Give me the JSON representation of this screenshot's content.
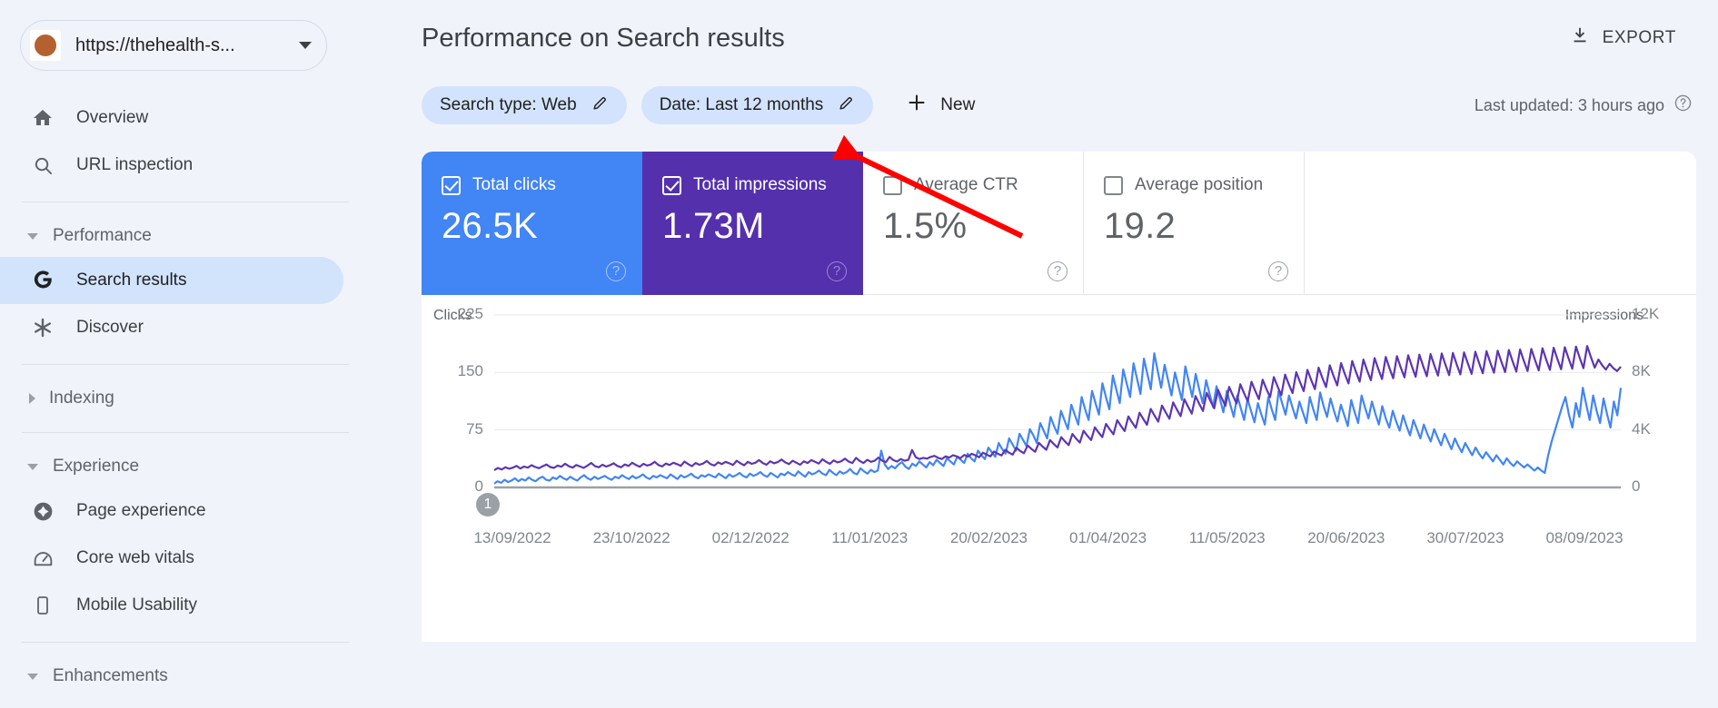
{
  "sidebar": {
    "property": {
      "url": "https://thehealth-s...",
      "favicon_color": "#b5602f",
      "dropdown_icon": "chevron-down-icon"
    },
    "items": [
      {
        "label": "Overview",
        "icon": "home-icon",
        "type": "item",
        "selected": false
      },
      {
        "label": "URL inspection",
        "icon": "search-icon",
        "type": "item",
        "selected": false
      },
      {
        "label": "Performance",
        "icon": "chevron-down-icon",
        "type": "group",
        "expanded": true
      },
      {
        "label": "Search results",
        "icon": "google-g-icon",
        "type": "item",
        "selected": true
      },
      {
        "label": "Discover",
        "icon": "asterisk-icon",
        "type": "item",
        "selected": false
      },
      {
        "label": "Indexing",
        "icon": "chevron-right-icon",
        "type": "group",
        "expanded": false
      },
      {
        "label": "Experience",
        "icon": "chevron-down-icon",
        "type": "group",
        "expanded": true
      },
      {
        "label": "Page experience",
        "icon": "page-experience-icon",
        "type": "item",
        "selected": false
      },
      {
        "label": "Core web vitals",
        "icon": "speedometer-icon",
        "type": "item",
        "selected": false
      },
      {
        "label": "Mobile Usability",
        "icon": "mobile-phone-icon",
        "type": "item",
        "selected": false
      },
      {
        "label": "Enhancements",
        "icon": "chevron-down-icon",
        "type": "group",
        "expanded": true
      }
    ]
  },
  "header": {
    "title": "Performance on Search results",
    "export_label": "EXPORT",
    "export_icon": "download-icon"
  },
  "filters": {
    "chips": [
      {
        "label": "Search type: Web",
        "edit_icon": "pencil-icon"
      },
      {
        "label": "Date: Last 12 months",
        "edit_icon": "pencil-icon"
      }
    ],
    "new_label": "New",
    "new_icon": "plus-icon",
    "last_updated": "Last updated: 3 hours ago",
    "help_icon": "question-mark-icon"
  },
  "metrics": [
    {
      "name": "Total clicks",
      "value": "26.5K",
      "checked": true,
      "color": "#4285f4",
      "help_icon": "question-mark-icon"
    },
    {
      "name": "Total impressions",
      "value": "1.73M",
      "checked": true,
      "color": "#5430ad",
      "help_icon": "question-mark-icon"
    },
    {
      "name": "Average CTR",
      "value": "1.5%",
      "checked": false,
      "color": "#ffffff",
      "help_icon": "question-mark-icon"
    },
    {
      "name": "Average position",
      "value": "19.2",
      "checked": false,
      "color": "#ffffff",
      "help_icon": "question-mark-icon"
    }
  ],
  "annotation": {
    "marker_label": "1"
  },
  "chart_data": {
    "type": "line",
    "title": "",
    "xlabel": "",
    "ylabel": "Clicks",
    "y2label": "Impressions",
    "grid": true,
    "legend": "none",
    "ylim": [
      0,
      225
    ],
    "y2lim": [
      0,
      12000
    ],
    "yticks": [
      "0",
      "75",
      "150",
      "225"
    ],
    "y2ticks": [
      "0",
      "4K",
      "8K",
      "12K"
    ],
    "xticks": [
      "13/09/2022",
      "23/10/2022",
      "02/12/2022",
      "11/01/2023",
      "20/02/2023",
      "01/04/2023",
      "11/05/2023",
      "20/06/2023",
      "30/07/2023",
      "08/09/2023"
    ],
    "series": [
      {
        "name": "Clicks",
        "color": "#4285f4",
        "axis": "left",
        "values": [
          5,
          8,
          6,
          10,
          7,
          9,
          12,
          8,
          11,
          9,
          13,
          10,
          8,
          12,
          14,
          10,
          9,
          13,
          11,
          15,
          12,
          10,
          14,
          11,
          9,
          13,
          16,
          12,
          10,
          14,
          11,
          13,
          15,
          12,
          10,
          14,
          12,
          16,
          13,
          11,
          15,
          12,
          14,
          17,
          13,
          11,
          15,
          13,
          16,
          14,
          12,
          17,
          14,
          11,
          16,
          13,
          15,
          18,
          14,
          12,
          16,
          14,
          17,
          15,
          13,
          18,
          15,
          12,
          17,
          14,
          16,
          19,
          15,
          13,
          18,
          15,
          17,
          20,
          16,
          14,
          19,
          16,
          13,
          18,
          16,
          20,
          17,
          15,
          21,
          17,
          14,
          20,
          17,
          19,
          22,
          18,
          16,
          23,
          19,
          16,
          21,
          18,
          20,
          24,
          19,
          17,
          25,
          21,
          18,
          23,
          20,
          22,
          48,
          30,
          24,
          28,
          25,
          30,
          33,
          27,
          24,
          31,
          28,
          34,
          30,
          26,
          33,
          29,
          36,
          32,
          28,
          38,
          34,
          30,
          40,
          36,
          32,
          44,
          38,
          34,
          48,
          42,
          37,
          52,
          46,
          40,
          58,
          50,
          44,
          64,
          56,
          48,
          70,
          62,
          54,
          76,
          68,
          58,
          84,
          74,
          64,
          92,
          80,
          70,
          100,
          88,
          76,
          108,
          95,
          82,
          118,
          102,
          88,
          126,
          110,
          95,
          136,
          118,
          102,
          146,
          128,
          110,
          154,
          136,
          118,
          162,
          142,
          122,
          168,
          148,
          128,
          175,
          152,
          130,
          160,
          140,
          120,
          150,
          132,
          114,
          158,
          138,
          118,
          148,
          128,
          110,
          140,
          122,
          105,
          132,
          115,
          98,
          126,
          108,
          92,
          120,
          104,
          88,
          115,
          100,
          85,
          110,
          95,
          82,
          118,
          102,
          88,
          126,
          110,
          95,
          120,
          104,
          90,
          112,
          98,
          84,
          118,
          102,
          88,
          124,
          106,
          92,
          116,
          100,
          86,
          108,
          94,
          80,
          114,
          98,
          84,
          120,
          104,
          90,
          112,
          96,
          82,
          106,
          90,
          78,
          100,
          86,
          74,
          94,
          80,
          68,
          88,
          76,
          64,
          82,
          70,
          60,
          76,
          65,
          55,
          70,
          60,
          50,
          64,
          54,
          46,
          58,
          50,
          42,
          52,
          44,
          38,
          46,
          40,
          34,
          42,
          36,
          30,
          38,
          32,
          28,
          34,
          30,
          26,
          30,
          26,
          22,
          26,
          22,
          19,
          42,
          60,
          75,
          90,
          105,
          118,
          95,
          78,
          110,
          92,
          130,
          108,
          88,
          120,
          100,
          84,
          116,
          96,
          78,
          112,
          94,
          130
        ]
      },
      {
        "name": "Impressions",
        "color": "#5e35b1",
        "axis": "right",
        "values": [
          1200,
          1350,
          1250,
          1400,
          1300,
          1380,
          1500,
          1320,
          1450,
          1380,
          1550,
          1420,
          1340,
          1480,
          1600,
          1420,
          1360,
          1520,
          1440,
          1650,
          1480,
          1380,
          1560,
          1460,
          1360,
          1520,
          1700,
          1480,
          1400,
          1580,
          1450,
          1540,
          1680,
          1500,
          1400,
          1600,
          1500,
          1720,
          1560,
          1440,
          1640,
          1520,
          1600,
          1780,
          1560,
          1460,
          1660,
          1560,
          1720,
          1620,
          1500,
          1800,
          1620,
          1480,
          1700,
          1580,
          1660,
          1840,
          1620,
          1520,
          1740,
          1620,
          1780,
          1680,
          1560,
          1860,
          1680,
          1540,
          1780,
          1640,
          1720,
          1900,
          1700,
          1580,
          1820,
          1680,
          1760,
          1940,
          1740,
          1620,
          1860,
          1720,
          1580,
          1820,
          1700,
          1900,
          1780,
          1660,
          1960,
          1780,
          1640,
          1880,
          1740,
          1820,
          2000,
          1800,
          1700,
          2060,
          1840,
          1700,
          1920,
          1780,
          1860,
          2080,
          1860,
          1760,
          2120,
          1900,
          1800,
          1980,
          1860,
          1920,
          2600,
          2100,
          1980,
          2060,
          2000,
          2120,
          2200,
          2060,
          1980,
          2160,
          2080,
          2240,
          2160,
          2040,
          2260,
          2140,
          2340,
          2220,
          2100,
          2420,
          2280,
          2160,
          2500,
          2340,
          2220,
          2620,
          2420,
          2280,
          2760,
          2540,
          2380,
          2920,
          2680,
          2480,
          3100,
          2840,
          2620,
          3300,
          3020,
          2780,
          3500,
          3200,
          2940,
          3720,
          3400,
          3120,
          3940,
          3600,
          3300,
          4180,
          3820,
          3500,
          4420,
          4040,
          3700,
          4680,
          4280,
          3920,
          4940,
          4520,
          4140,
          5200,
          4760,
          4360,
          5460,
          5000,
          4580,
          5700,
          5220,
          4780,
          5920,
          5420,
          4960,
          6140,
          5620,
          5140,
          6360,
          5820,
          5320,
          6580,
          6020,
          5500,
          6800,
          6220,
          5680,
          7000,
          6400,
          5840,
          7180,
          6560,
          6000,
          7350,
          6720,
          6140,
          7500,
          6860,
          6280,
          7680,
          7020,
          6420,
          7850,
          7180,
          6560,
          8020,
          7340,
          6700,
          8180,
          7480,
          6840,
          8340,
          7620,
          6980,
          8500,
          7760,
          7100,
          8650,
          7900,
          7240,
          8800,
          8040,
          7360,
          8900,
          8140,
          7460,
          9000,
          8240,
          7540,
          9080,
          8300,
          7600,
          9140,
          8360,
          7660,
          9200,
          8420,
          7700,
          9240,
          8460,
          7740,
          9280,
          8500,
          7780,
          9320,
          8540,
          7820,
          9360,
          8580,
          7860,
          9400,
          8620,
          7900,
          9440,
          8660,
          7940,
          9480,
          8700,
          7980,
          9520,
          8740,
          8020,
          9560,
          8780,
          8060,
          9600,
          8820,
          8100,
          9640,
          8860,
          8140,
          9680,
          8900,
          8180,
          9720,
          8940,
          8220,
          9760,
          8980,
          8260,
          9800,
          9020,
          8300,
          9840,
          9060,
          8340,
          8900,
          8500,
          8200,
          8600,
          8300,
          8100,
          8400
        ]
      }
    ]
  }
}
